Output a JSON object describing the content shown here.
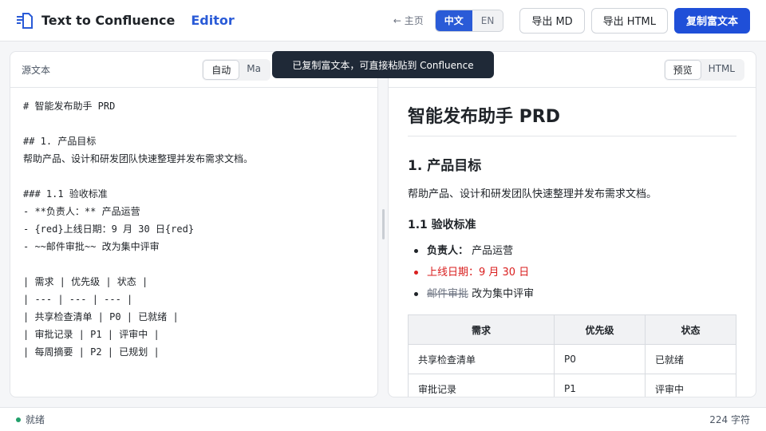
{
  "header": {
    "title": "Text to Confluence",
    "subtitle": "Editor",
    "home_link": "← 主页",
    "lang": [
      "中文",
      "EN"
    ],
    "export_md": "导出 MD",
    "export_html": "导出 HTML",
    "copy_rich": "复制富文本"
  },
  "left_panel": {
    "title": "源文本",
    "modes": [
      "自动",
      "Ma"
    ],
    "source_text": "# 智能发布助手 PRD\n\n## 1. 产品目标\n帮助产品、设计和研发团队快速整理并发布需求文档。\n\n### 1.1 验收标准\n- **负责人：** 产品运营\n- {red}上线日期：9 月 30 日{red}\n- ~~邮件审批~~ 改为集中评审\n\n| 需求 | 优先级 | 状态 |\n| --- | --- | --- |\n| 共享检查清单 | P0 | 已就绪 |\n| 审批记录 | P1 | 评审中 |\n| 每周摘要 | P2 | 已规划 |"
  },
  "right_panel": {
    "tabs": [
      "预览",
      "HTML"
    ],
    "h1": "智能发布助手 PRD",
    "h2": "1. 产品目标",
    "paragraph": "帮助产品、设计和研发团队快速整理并发布需求文档。",
    "h3": "1.1 验收标准",
    "bullets": {
      "owner_label": "负责人：",
      "owner_value": " 产品运营",
      "date": "上线日期：9 月 30 日",
      "strike": "邮件审批",
      "strike_rest": " 改为集中评审"
    },
    "table": {
      "headers": [
        "需求",
        "优先级",
        "状态"
      ],
      "rows": [
        [
          "共享检查清单",
          "P0",
          "已就绪"
        ],
        [
          "审批记录",
          "P1",
          "评审中"
        ]
      ]
    }
  },
  "toast": "已复制富文本，可直接粘贴到 Confluence",
  "status": {
    "state": "就绪",
    "char_count": "224 字符"
  },
  "colors": {
    "accent": "#1f4fd8",
    "highlight_red": "#d91e1e",
    "ready_green": "#22a06b"
  }
}
